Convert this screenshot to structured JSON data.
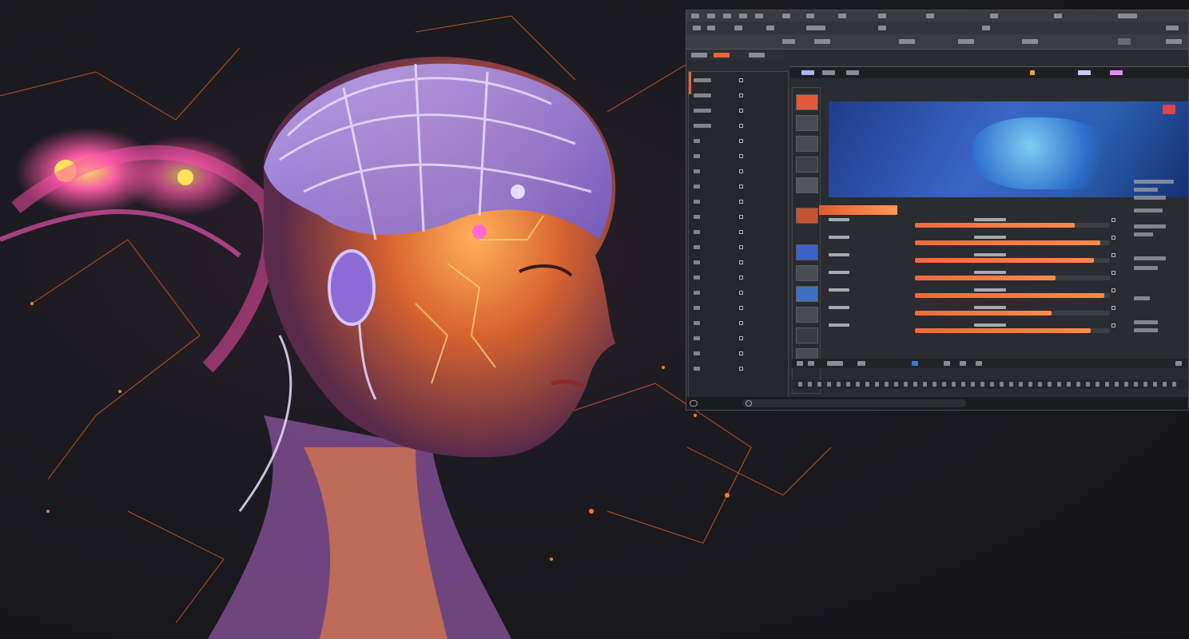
{
  "scene": {
    "description_visible_text": ""
  },
  "colors": {
    "accent": "#f06a3c",
    "background": "#16161b",
    "panel": "#2b2c31",
    "preview": "#2f5fb8"
  },
  "app": {
    "toolbar_label": "",
    "sidebar_rows": [
      "",
      "",
      "",
      "",
      "",
      "",
      "",
      "",
      "",
      "",
      "",
      "",
      "",
      "",
      "",
      "",
      "",
      "",
      "",
      ""
    ],
    "properties": [
      {
        "label": "",
        "value": 0.82
      },
      {
        "label": "",
        "value": 0.95
      },
      {
        "label": "",
        "value": 0.92
      },
      {
        "label": "",
        "value": 0.72
      },
      {
        "label": "",
        "value": 0.97
      },
      {
        "label": "",
        "value": 0.7
      },
      {
        "label": "",
        "value": 0.9
      }
    ],
    "status_search": ""
  }
}
